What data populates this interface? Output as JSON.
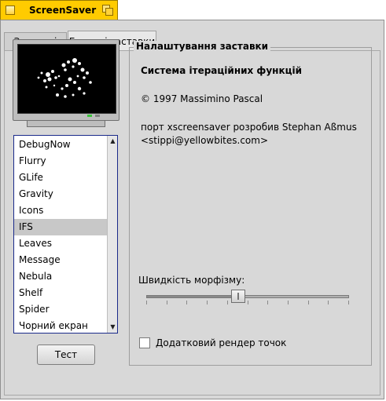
{
  "window": {
    "title": "ScreenSaver"
  },
  "tabs": [
    {
      "label": "Загальні"
    },
    {
      "label": "Екранні заставки"
    }
  ],
  "list": {
    "items": [
      "DebugNow",
      "Flurry",
      "GLife",
      "Gravity",
      "Icons",
      "IFS",
      "Leaves",
      "Message",
      "Nebula",
      "Shelf",
      "Spider",
      "Чорний екран"
    ],
    "selected": "IFS"
  },
  "test_button": "Тест",
  "settings": {
    "legend": "Налаштування заставки",
    "module_title": "Система ітераційних функцій",
    "copyright": "© 1997 Massimino Pascal",
    "port_line1": "порт xscreensaver розробив Stephan Aßmus",
    "port_line2": "<stippi@yellowbites.com>",
    "speed_label": "Швидкість морфізму:",
    "speed_value": 0.45,
    "checkbox_label": "Додатковий рендер точок",
    "checkbox_checked": false
  },
  "colors": {
    "title_tab": "#ffcb00",
    "window_bg": "#d8d8d8",
    "list_border": "#1a2a8a",
    "selected_row": "#c8c8c8"
  },
  "icons": [
    "close-icon",
    "zoom-icon",
    "scroll-up-icon",
    "scroll-down-icon"
  ]
}
